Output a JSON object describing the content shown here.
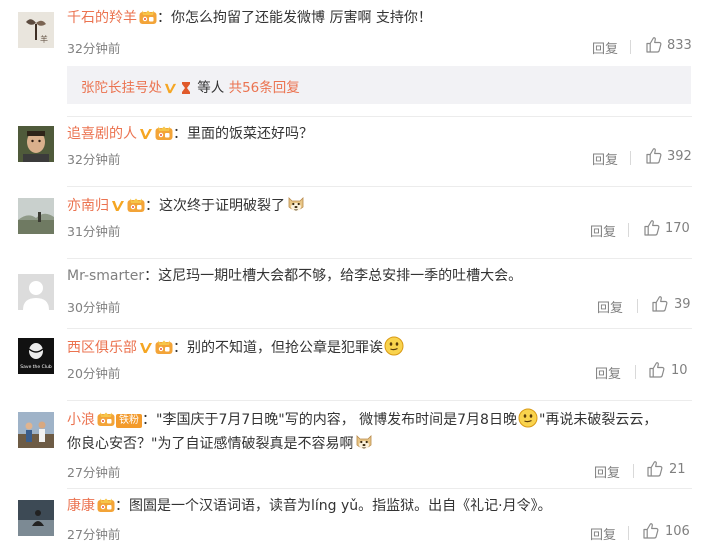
{
  "comments": [
    {
      "username": "千石的羚羊",
      "text": "：你怎么拘留了还能发微博 厉害啊 支持你！",
      "time": "32分钟前",
      "reply": "回复",
      "likes": "833"
    },
    {
      "username": "追喜剧的人",
      "text": "：里面的饭菜还好吗？",
      "time": "32分钟前",
      "reply": "回复",
      "likes": "392"
    },
    {
      "username": "亦南归",
      "text": "：这次终于证明破裂了",
      "time": "31分钟前",
      "reply": "回复",
      "likes": "170"
    },
    {
      "username": "Mr-smarter",
      "text": "：这尼玛一期吐槽大会都不够，给李总安排一季的吐槽大会。",
      "time": "30分钟前",
      "reply": "回复",
      "likes": "39"
    },
    {
      "username": "西区俱乐部",
      "text": "：别的不知道，但抢公章是犯罪诶",
      "time": "20分钟前",
      "reply": "回复",
      "likes": "10"
    },
    {
      "username": "小浪",
      "badge_label": "铁粉",
      "text_line1a": "：\"李国庆于7月7日晚\"写的内容， 微博发布时间是7月8日晚",
      "text_line1b": "\"再说未破裂云云，",
      "text_line2": "你良心安否？\"为了自证感情破裂真是不容易啊",
      "time": "27分钟前",
      "reply": "回复",
      "likes": "21"
    },
    {
      "username": "康康",
      "text": "：图圄是一个汉语词语，读音为líng yǔ。指监狱。出自《礼记·月令》。",
      "time": "27分钟前",
      "reply": "回复",
      "likes": "106"
    }
  ],
  "sub_replies": {
    "user": "张陀长挂号处",
    "suffix": "等人",
    "count_label": "共56条回复"
  },
  "avatar_labels": {
    "xiqu": "Save the Club"
  },
  "colors": {
    "username": "#eb7350",
    "gray_text": "#808080",
    "sub_box_bg": "#f2f2f5",
    "verified_v": "#f5a623"
  }
}
